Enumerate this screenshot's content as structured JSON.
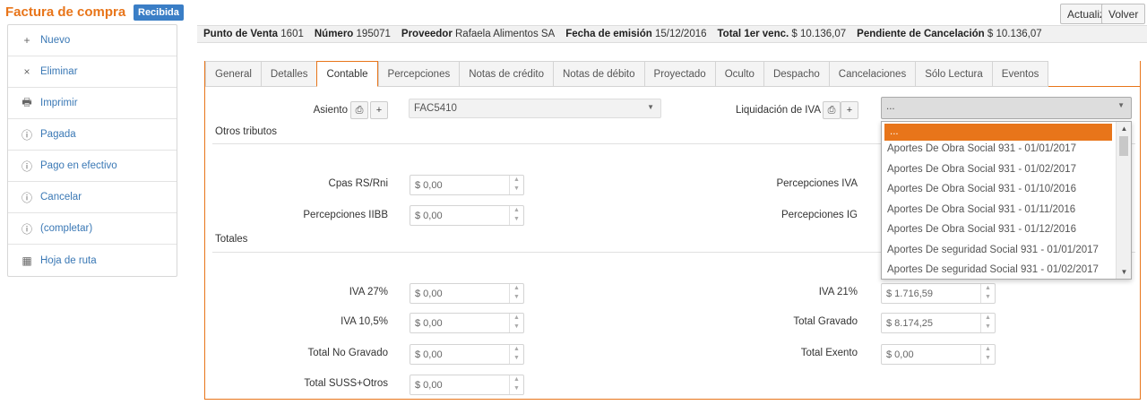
{
  "header": {
    "title": "Factura de compra",
    "badge": "Recibida",
    "actions": {
      "refresh": "Actualizar",
      "back": "Volver"
    }
  },
  "sidebar": {
    "items": [
      {
        "icon": "+",
        "label": "Nuevo"
      },
      {
        "icon": "×",
        "label": "Eliminar"
      },
      {
        "icon": "🖶",
        "label": "Imprimir"
      },
      {
        "icon": "ⓘ",
        "label": "Pagada"
      },
      {
        "icon": "ⓘ",
        "label": "Pago en efectivo"
      },
      {
        "icon": "ⓘ",
        "label": "Cancelar"
      },
      {
        "icon": "ⓘ",
        "label": "(completar)"
      },
      {
        "icon": "▦",
        "label": "Hoja de ruta"
      }
    ]
  },
  "info": [
    {
      "key": "Punto de Venta",
      "value": "1601"
    },
    {
      "key": "Número",
      "value": "195071"
    },
    {
      "key": "Proveedor",
      "value": "Rafaela Alimentos SA"
    },
    {
      "key": "Fecha de emisión",
      "value": "15/12/2016"
    },
    {
      "key": "Total 1er venc.",
      "value": "$ 10.136,07"
    },
    {
      "key": "Pendiente de Cancelación",
      "value": "$ 10.136,07"
    }
  ],
  "tabs": [
    "General",
    "Detalles",
    "Contable",
    "Percepciones",
    "Notas de crédito",
    "Notas de débito",
    "Proyectado",
    "Oculto",
    "Despacho",
    "Cancelaciones",
    "Sólo Lectura",
    "Eventos"
  ],
  "contable": {
    "asiento_label": "Asiento",
    "asiento_value": "FAC5410",
    "liquidacion_label": "Liquidación de IVA",
    "liquidacion_value": "...",
    "otros_tributos": "Otros tributos",
    "totales": "Totales",
    "fields": {
      "cpas": {
        "label": "Cpas RS/Rni",
        "value": "$ 0,00"
      },
      "perc_iibb": {
        "label": "Percepciones IIBB",
        "value": "$ 0,00"
      },
      "perc_iva": {
        "label": "Percepciones IVA"
      },
      "perc_ig": {
        "label": "Percepciones IG"
      },
      "iva27": {
        "label": "IVA 27%",
        "value": "$ 0,00"
      },
      "iva105": {
        "label": "IVA 10,5%",
        "value": "$ 0,00"
      },
      "total_no_gravado": {
        "label": "Total No Gravado",
        "value": "$ 0,00"
      },
      "total_suss": {
        "label": "Total SUSS+Otros",
        "value": "$ 0,00"
      },
      "iva21": {
        "label": "IVA 21%",
        "value": "$ 1.716,59"
      },
      "total_gravado": {
        "label": "Total Gravado",
        "value": "$ 8.174,25"
      },
      "total_exento": {
        "label": "Total Exento",
        "value": "$ 0,00"
      }
    }
  },
  "dropdown": {
    "options": [
      "...",
      "Aportes De Obra Social 931 - 01/01/2017",
      "Aportes De Obra Social 931 - 01/02/2017",
      "Aportes De Obra Social 931 - 01/10/2016",
      "Aportes De Obra Social 931 - 01/11/2016",
      "Aportes De Obra Social 931 - 01/12/2016",
      "Aportes De seguridad Social 931 - 01/01/2017",
      "Aportes De seguridad Social 931 - 01/02/2017"
    ]
  },
  "colors": {
    "accent": "#e8751a",
    "badge": "#3a7ec6",
    "link": "#3a78b5"
  }
}
